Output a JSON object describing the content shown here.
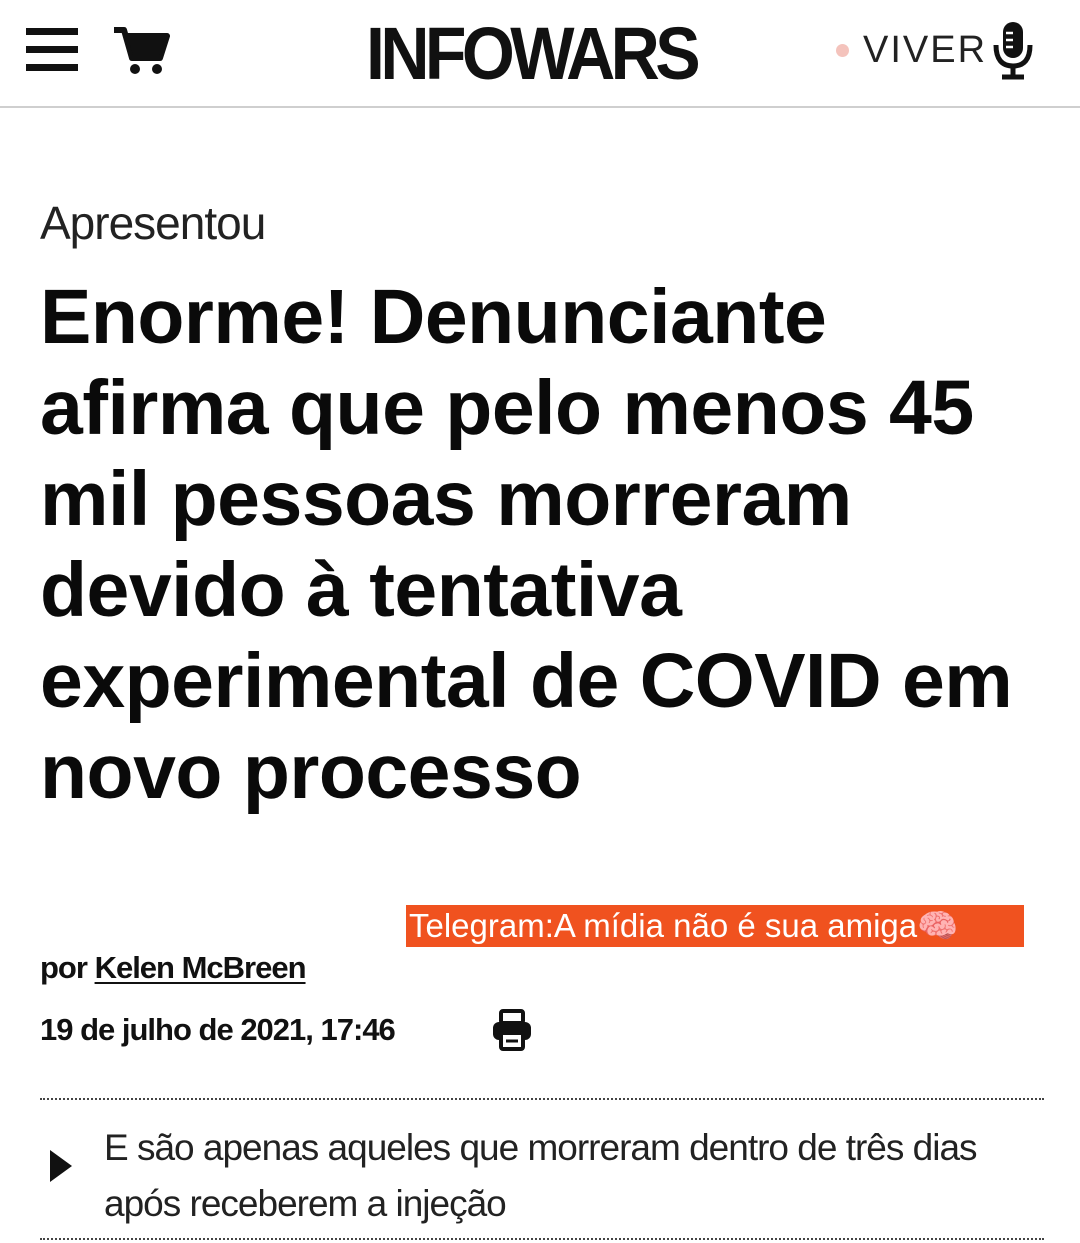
{
  "header": {
    "logo_text": "INFOWARS",
    "live_label": "VIVER",
    "icons": [
      "menu-icon",
      "cart-icon",
      "live-dot-icon",
      "microphone-icon"
    ]
  },
  "article": {
    "category": "Apresentou",
    "headline": "Enorme! Denunciante afirma que pelo menos 45 mil pessoas morreram devido à tentativa experimental de COVID em novo processo",
    "overlay_banner": "Telegram:A mídia não é sua amiga🧠",
    "byline_prefix": "por",
    "author": "Kelen McBreen",
    "date": "19 de julho de 2021, 17:46",
    "subheadline": "E são apenas aqueles que morreram dentro de três dias após receberem a injeção"
  },
  "colors": {
    "banner_bg": "#f0521f",
    "live_dot": "#f4c3bc",
    "text": "#111111"
  }
}
